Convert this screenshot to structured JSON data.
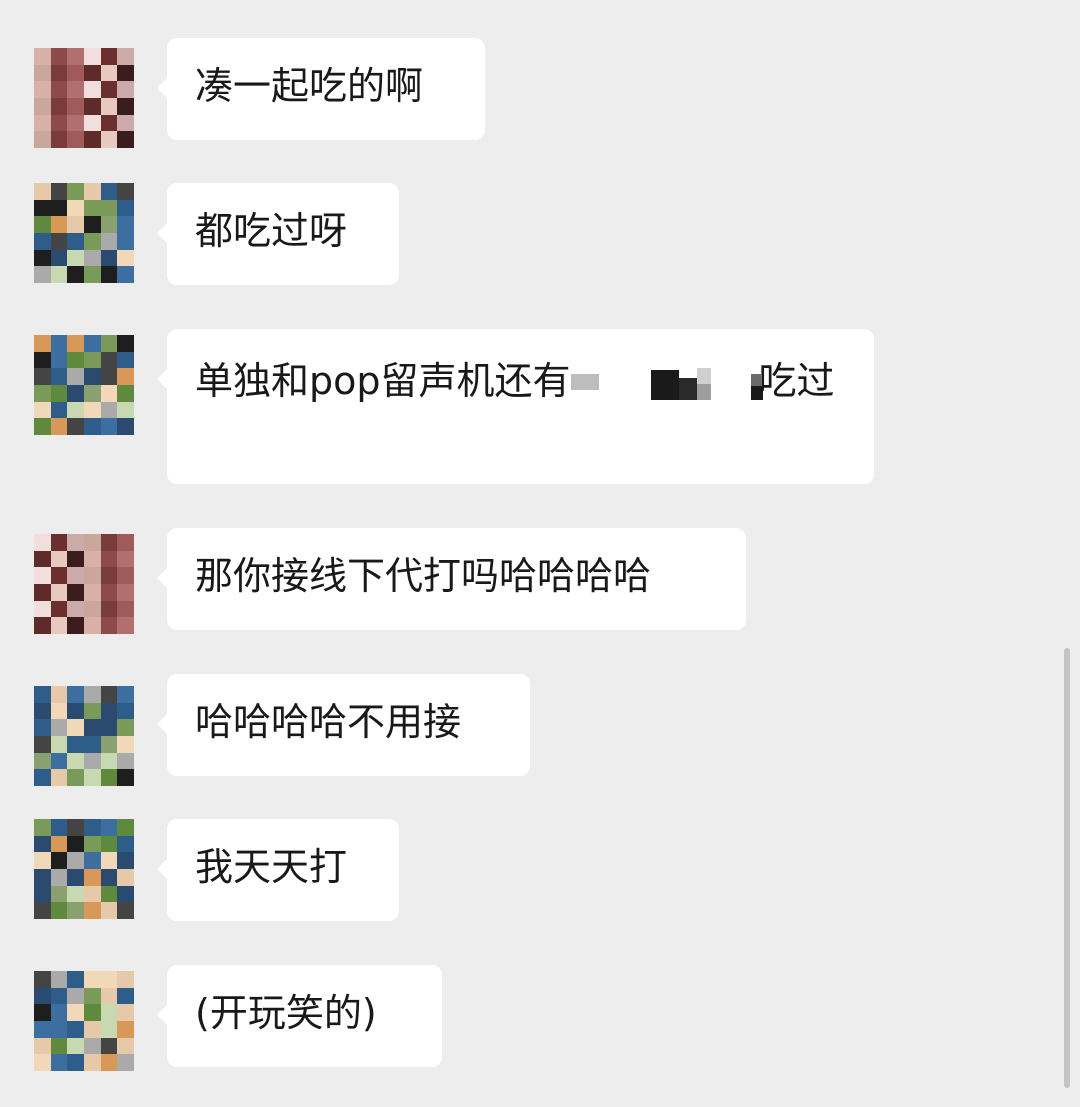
{
  "messages": [
    {
      "sender": "a",
      "text": "凑一起吃的啊"
    },
    {
      "sender": "b",
      "text": "都吃过呀"
    },
    {
      "sender": "b",
      "text_before": "单独和pop留声机还有",
      "text_after": "吃过"
    },
    {
      "sender": "a",
      "text": "那你接线下代打吗哈哈哈哈"
    },
    {
      "sender": "b",
      "text": "哈哈哈哈不用接"
    },
    {
      "sender": "b",
      "text": "我天天打"
    },
    {
      "sender": "b",
      "text": "(开玩笑的)"
    }
  ],
  "colors": {
    "background": "#ededed",
    "bubble": "#ffffff",
    "text": "#191919"
  }
}
